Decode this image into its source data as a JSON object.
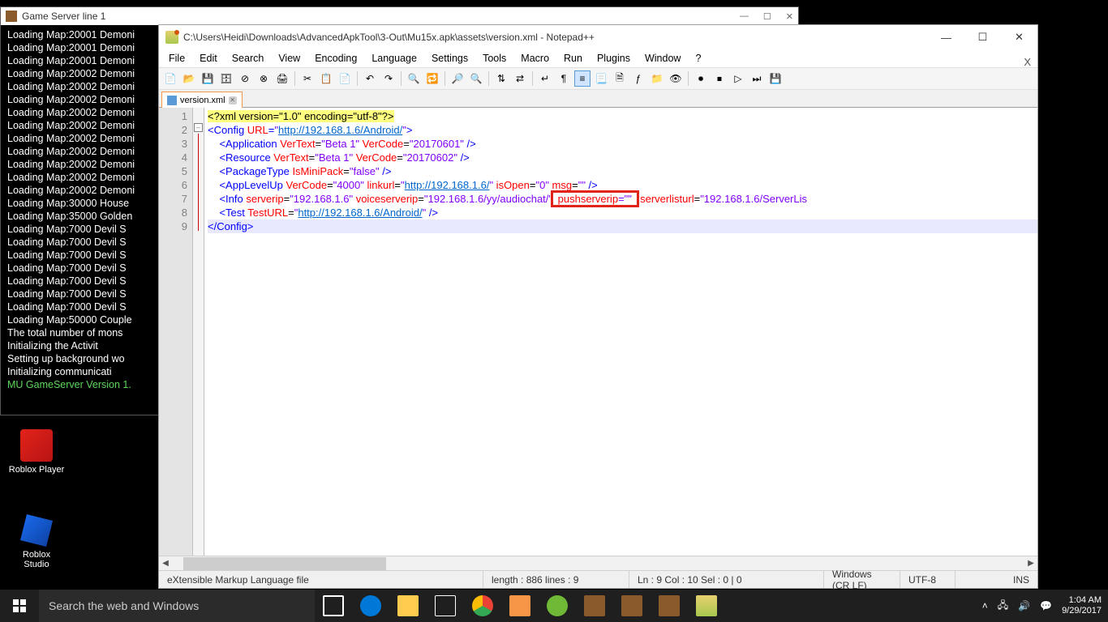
{
  "console": {
    "title": "Game Server line 1",
    "lines": [
      "Loading Map:20001 Demoni",
      "Loading Map:20001 Demoni",
      "Loading Map:20001 Demoni",
      "Loading Map:20002 Demoni",
      "Loading Map:20002 Demoni",
      "Loading Map:20002 Demoni",
      "Loading Map:20002 Demoni",
      "Loading Map:20002 Demoni",
      "Loading Map:20002 Demoni",
      "Loading Map:20002 Demoni",
      "Loading Map:20002 Demoni",
      "Loading Map:20002 Demoni",
      "Loading Map:20002 Demoni",
      "Loading Map:30000 House",
      "Loading Map:35000 Golden",
      "Loading Map:7000 Devil S",
      "Loading Map:7000 Devil S",
      "Loading Map:7000 Devil S",
      "Loading Map:7000 Devil S",
      "Loading Map:7000 Devil S",
      "Loading Map:7000 Devil S",
      "Loading Map:7000 Devil S",
      "Loading Map:50000 Couple",
      "The total number of mons",
      "Initializing the Activit",
      "Setting up background wo",
      "Initializing communicati"
    ],
    "last_line": "MU GameServer Version 1."
  },
  "icons": {
    "roblox_player": "Roblox Player",
    "roblox_studio": "Roblox\nStudio"
  },
  "npp": {
    "title": "C:\\Users\\Heidi\\Downloads\\AdvancedApkTool\\3-Out\\Mu15x.apk\\assets\\version.xml - Notepad++",
    "menu": [
      "File",
      "Edit",
      "Search",
      "View",
      "Encoding",
      "Language",
      "Settings",
      "Tools",
      "Macro",
      "Run",
      "Plugins",
      "Window",
      "?"
    ],
    "tab": "version.xml",
    "lines": [
      "1",
      "2",
      "3",
      "4",
      "5",
      "6",
      "7",
      "8",
      "9"
    ],
    "code": {
      "l1_decl": "<?xml version=\"1.0\" encoding=\"utf-8\"?>",
      "l2_open": "<",
      "l2_tag": "Config",
      "l2_a1": " URL",
      "l2_eq": "=",
      "l2_q": "\"",
      "l2_url": "http://192.168.1.6/Android/",
      "l2_close": ">",
      "l3_tag": "Application",
      "l3_a1": " VerText",
      "l3_v1": "\"Beta 1\"",
      "l3_a2": " VerCode",
      "l3_v2": "\"20170601\"",
      "l4_tag": "Resource",
      "l4_a1": " VerText",
      "l4_v1": "\"Beta 1\"",
      "l4_a2": " VerCode",
      "l4_v2": "\"20170602\"",
      "l5_tag": "PackageType",
      "l5_a1": " IsMiniPack",
      "l5_v1": "\"false\"",
      "l6_tag": "AppLevelUp",
      "l6_a1": " VerCode",
      "l6_v1": "\"4000\"",
      "l6_a2": " linkurl",
      "l6_q": "\"",
      "l6_url": "http://192.168.1.6/",
      "l6_a3": " isOpen",
      "l6_v3": "\"0\"",
      "l6_a4": " msg",
      "l6_v4": "\"\"",
      "l7_tag": "Info",
      "l7_a1": " serverip",
      "l7_v1": "\"192.168.1.6\"",
      "l7_a2": " voiceserverip",
      "l7_v2": "\"192.168.1.6/yy/audiochat/\"",
      "l7_a3": " pushserverip",
      "l7_v3": "=\"\"",
      "l7_a4": " serverlisturl",
      "l7_v4": "\"192.168.1.6/ServerLis",
      "l8_tag": "Test",
      "l8_a1": " TestURL",
      "l8_q": "\"",
      "l8_url": "http://192.168.1.6/Android/",
      "l9_close": "</",
      "l9_tag": "Config",
      "l9_gt": ">"
    },
    "status": {
      "lang": "eXtensible Markup Language file",
      "len": "length : 886    lines : 9",
      "pos": "Ln : 9    Col : 10    Sel : 0 | 0",
      "eol": "Windows (CR LF)",
      "enc": "UTF-8",
      "ins": "INS"
    }
  },
  "taskbar": {
    "search_placeholder": "Search the web and Windows",
    "time": "1:04 AM",
    "date": "9/29/2017"
  }
}
